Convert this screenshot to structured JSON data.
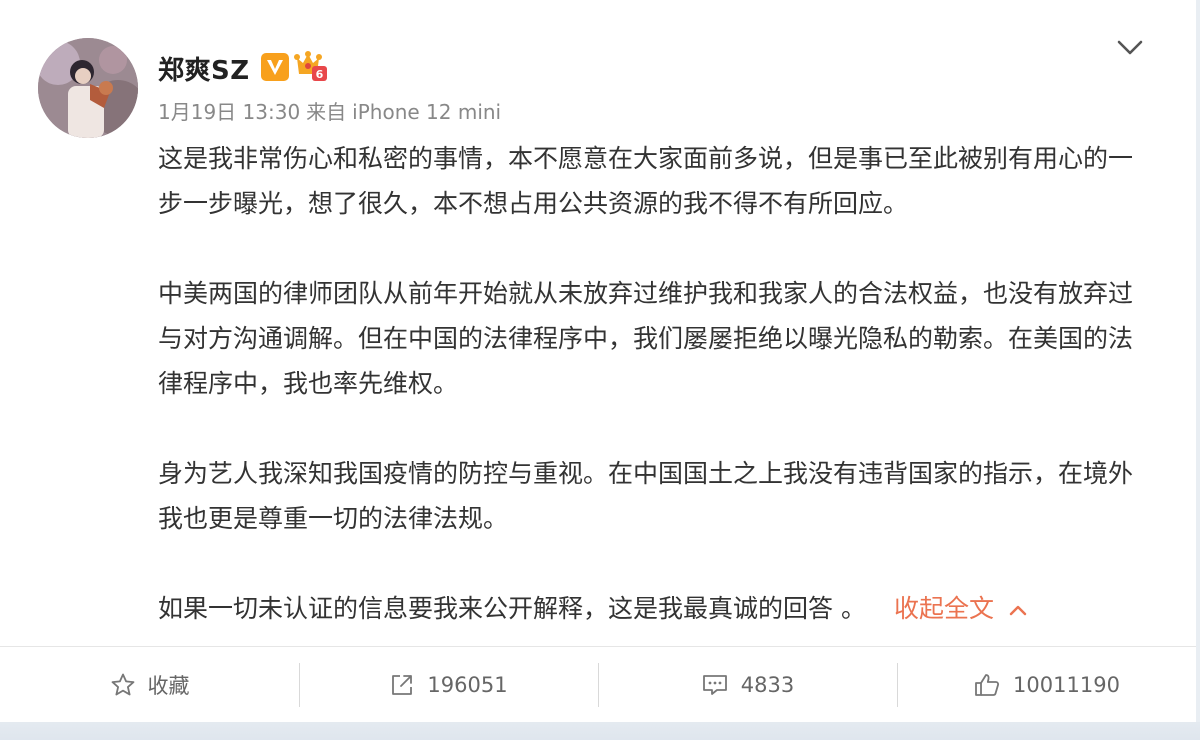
{
  "post": {
    "author": "郑爽SZ",
    "date": "1月19日 13:30",
    "source_prefix": "来自",
    "source": "iPhone 12 mini",
    "paragraphs": [
      "这是我非常伤心和私密的事情，本不愿意在大家面前多说，但是事已至此被别有用心的一步一步曝光，想了很久，本不想占用公共资源的我不得不有所回应。",
      "中美两国的律师团队从前年开始就从未放弃过维护我和我家人的合法权益，也没有放弃过与对方沟通调解。但在中国的法律程序中，我们屡屡拒绝以曝光隐私的勒索。在美国的法律程序中，我也率先维权。",
      "身为艺人我深知我国疫情的防控与重视。在中国国土之上我没有违背国家的指示，在境外我也更是尊重一切的法律法规。"
    ],
    "last_paragraph": "如果一切未认证的信息要我来公开解释，这是我最真诚的回答 。",
    "collapse_label": "收起全文"
  },
  "actions": {
    "favorite_label": "收藏",
    "repost_count": "196051",
    "comment_count": "4833",
    "like_count": "10011190"
  },
  "icons": {
    "verified": "verified-v-icon",
    "vip": "vip-crown-icon",
    "more": "chevron-down-icon",
    "favorite": "star-icon",
    "repost": "share-arrow-icon",
    "comment": "comment-bubble-icon",
    "like": "thumbs-up-icon",
    "collapse": "chevron-up-icon"
  },
  "colors": {
    "accent_link": "#eb7350",
    "verified_orange": "#f8a01c",
    "text": "#333333",
    "meta": "#888888"
  }
}
